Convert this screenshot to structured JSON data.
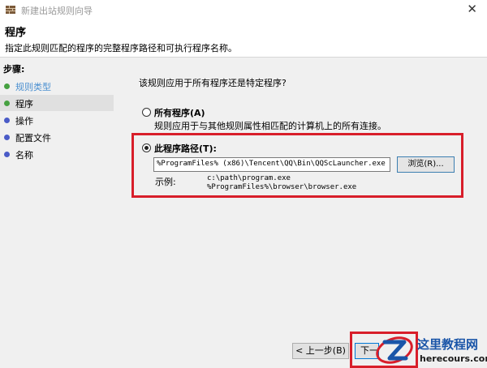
{
  "window": {
    "title": "新建出站规则向导",
    "close_glyph": "✕"
  },
  "header": {
    "title": "程序",
    "description": "指定此规则匹配的程序的完整程序路径和可执行程序名称。"
  },
  "sidebar": {
    "steps_title": "步骤:",
    "items": [
      {
        "label": "规则类型",
        "dot_color": "#46a141",
        "state": "done"
      },
      {
        "label": "程序",
        "dot_color": "#46a141",
        "state": "current"
      },
      {
        "label": "操作",
        "dot_color": "#4a5bc7",
        "state": "pending"
      },
      {
        "label": "配置文件",
        "dot_color": "#4a5bc7",
        "state": "pending"
      },
      {
        "label": "名称",
        "dot_color": "#4a5bc7",
        "state": "pending"
      }
    ]
  },
  "main": {
    "question": "该规则应用于所有程序还是特定程序?",
    "all_programs": {
      "label": "所有程序(A)",
      "description": "规则应用于与其他规则属性相匹配的计算机上的所有连接。",
      "checked": false
    },
    "this_program": {
      "label": "此程序路径(T):",
      "checked": true,
      "path_value": "%ProgramFiles% (x86)\\Tencent\\QQ\\Bin\\QQScLauncher.exe",
      "browse_label": "浏览(R)...",
      "example_label": "示例:",
      "example_line1": "c:\\path\\program.exe",
      "example_line2": "%ProgramFiles%\\browser\\browser.exe"
    }
  },
  "footer": {
    "back_label": "< 上一步(B)",
    "next_label": "下一步(N) >"
  },
  "watermark": {
    "name": "这里教程网",
    "url": "herecours.com"
  },
  "colors": {
    "highlight_red": "#d81e2a",
    "accent_blue": "#0078d7"
  }
}
